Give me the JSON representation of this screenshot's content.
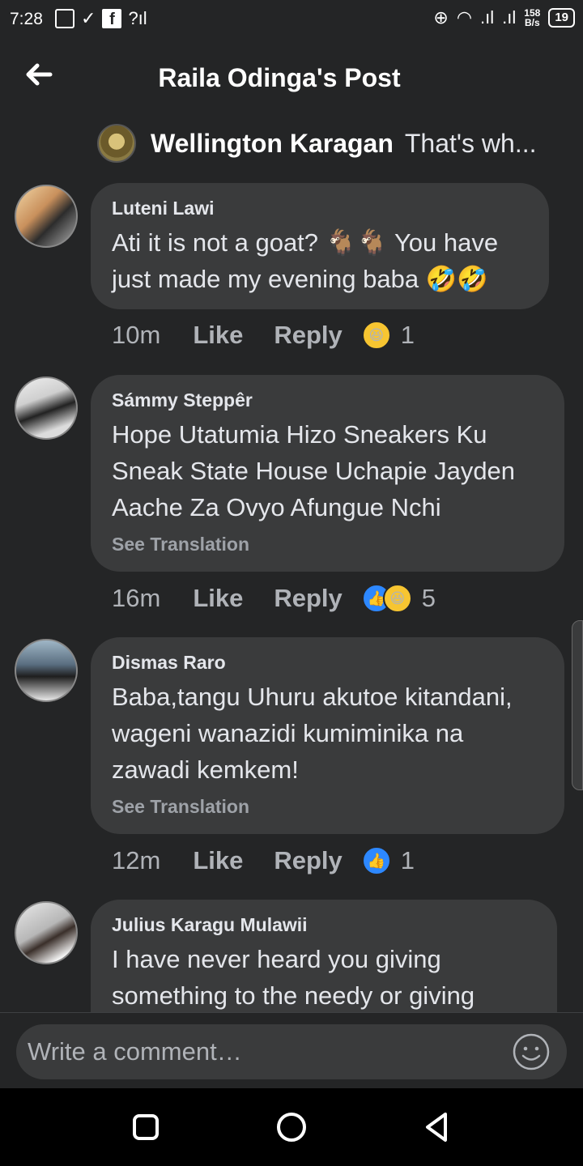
{
  "status_bar": {
    "time": "7:28",
    "speed_value": "158",
    "speed_unit": "B/s",
    "battery": "19"
  },
  "header": {
    "title": "Raila Odinga's Post"
  },
  "reply_context": {
    "name": "Wellington Karagan",
    "text": "That's wh..."
  },
  "comments": [
    {
      "name": "Luteni Lawi",
      "text_before": "Ati it is not a goat?",
      "emojis": [
        "🐐",
        "🐐",
        "🤣",
        "🤣"
      ],
      "text_after": "You have just made my evening baba",
      "time": "10m",
      "like": "Like",
      "reply": "Reply",
      "reactions": [
        "haha"
      ],
      "reaction_count": "1"
    },
    {
      "name": "Sámmy Steppêr",
      "text": "Hope Utatumia Hizo Sneakers Ku Sneak State House Uchapie Jayden Aache Za Ovyo Afungue Nchi",
      "see_translation": "See Translation",
      "time": "16m",
      "like": "Like",
      "reply": "Reply",
      "reactions": [
        "like",
        "haha"
      ],
      "reaction_count": "5"
    },
    {
      "name": "Dismas Raro",
      "text": "Baba,tangu Uhuru akutoe kitandani, wageni wanazidi kumiminika na zawadi kemkem!",
      "see_translation": "See Translation",
      "time": "12m",
      "like": "Like",
      "reply": "Reply",
      "reactions": [
        "like"
      ],
      "reaction_count": "1"
    },
    {
      "name": "Julius Karagu Mulawii",
      "text": "I have never heard you giving something to the needy or giving"
    }
  ],
  "composer": {
    "placeholder": "Write a comment…"
  },
  "colors": {
    "background": "#242526",
    "bubble": "#3a3b3c",
    "like_blue": "#2d88ff",
    "haha_yellow": "#f7c531"
  }
}
